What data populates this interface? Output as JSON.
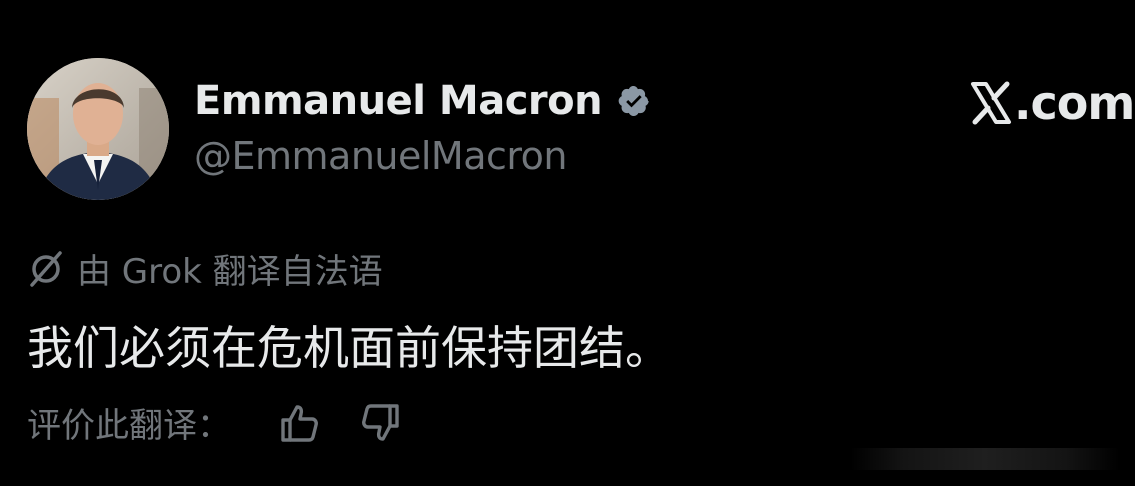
{
  "author": {
    "name": "Emmanuel Macron",
    "handle": "@EmmanuelMacron",
    "verified": true
  },
  "brand": {
    "text": ".com",
    "logo": "x-logo-icon"
  },
  "translation": {
    "note": "由 Grok 翻译自法语",
    "icon": "grok-icon"
  },
  "tweet": {
    "text": "我们必须在危机面前保持团结。"
  },
  "rating": {
    "label": "评价此翻译：",
    "up_icon": "thumbs-up-icon",
    "down_icon": "thumbs-down-icon"
  },
  "colors": {
    "background": "#000000",
    "primary_text": "#e7e9ea",
    "secondary_text": "#71767b",
    "verified_badge": "#8b98a5"
  }
}
